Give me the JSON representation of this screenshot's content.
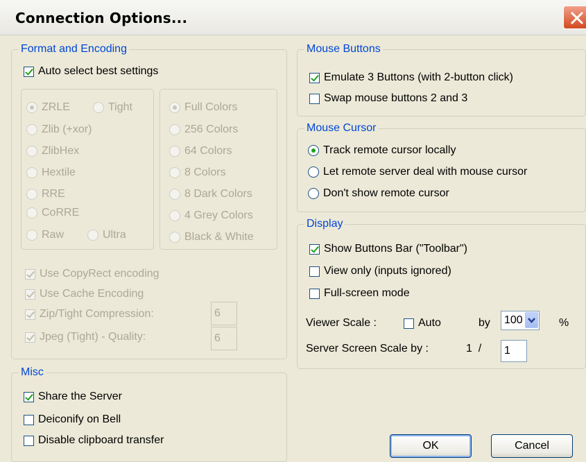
{
  "window": {
    "title": "Connection Options..."
  },
  "format_encoding": {
    "legend": "Format and Encoding",
    "auto_select": "Auto select best settings",
    "encodings": {
      "zrle": "ZRLE",
      "tight": "Tight",
      "zlib": "Zlib (+xor)",
      "zlibhex": "ZlibHex",
      "hextile": "Hextile",
      "rre": "RRE",
      "corre": "CoRRE",
      "raw": "Raw",
      "ultra": "Ultra"
    },
    "colors": [
      "Full Colors",
      "256 Colors",
      "64 Colors",
      "8 Colors",
      "8 Dark Colors",
      "4 Grey Colors",
      "Black & White"
    ],
    "copyrect": "Use CopyRect encoding",
    "cache": "Use Cache Encoding",
    "zip_tight": "Zip/Tight Compression:",
    "zip_value": "6",
    "jpeg": "Jpeg (Tight) - Quality:",
    "jpeg_value": "6"
  },
  "misc": {
    "legend": "Misc",
    "share": "Share the Server",
    "deiconify": "Deiconify on Bell",
    "clipboard": "Disable clipboard transfer"
  },
  "mouse_buttons": {
    "legend": "Mouse Buttons",
    "emulate": "Emulate 3 Buttons (with 2-button click)",
    "swap": "Swap mouse buttons 2 and 3"
  },
  "mouse_cursor": {
    "legend": "Mouse Cursor",
    "track": "Track remote cursor locally",
    "let_server": "Let remote server deal with mouse cursor",
    "dont_show": "Don't show remote cursor"
  },
  "display": {
    "legend": "Display",
    "toolbar": "Show Buttons Bar (\"Toolbar\")",
    "view_only": "View only (inputs ignored)",
    "fullscreen": "Full-screen mode",
    "viewer_scale": "Viewer Scale :",
    "auto": "Auto",
    "by": "by",
    "scale_value": "100",
    "percent": "%",
    "server_scale": "Server Screen Scale by :",
    "one_over": "1  /",
    "server_scale_value": "1"
  },
  "buttons": {
    "ok": "OK",
    "cancel": "Cancel"
  },
  "colors": {
    "legend": "#0046d5",
    "check": "#21a121",
    "close": "#d2491f"
  }
}
